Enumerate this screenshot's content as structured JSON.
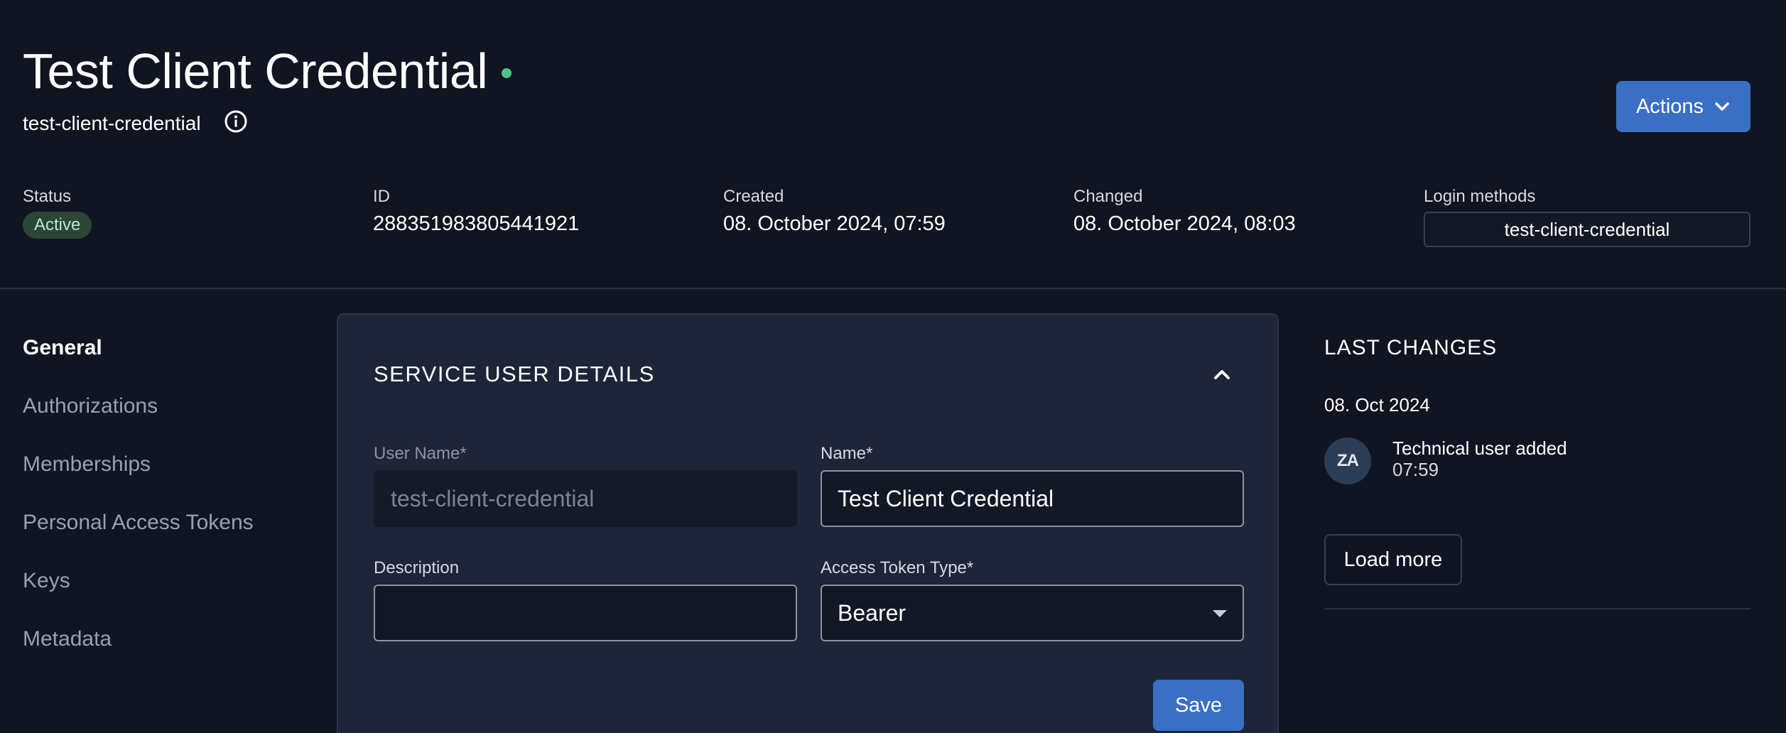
{
  "header": {
    "title": "Test Client Credential",
    "subtitle": "test-client-credential",
    "actions_label": "Actions",
    "status_dot_color": "#4fc38a"
  },
  "meta": {
    "status_label": "Status",
    "status_value": "Active",
    "id_label": "ID",
    "id_value": "288351983805441921",
    "created_label": "Created",
    "created_value": "08. October 2024, 07:59",
    "changed_label": "Changed",
    "changed_value": "08. October 2024, 08:03",
    "login_methods_label": "Login methods",
    "login_methods_value": "test-client-credential"
  },
  "nav": {
    "items": [
      {
        "label": "General",
        "active": true
      },
      {
        "label": "Authorizations"
      },
      {
        "label": "Memberships"
      },
      {
        "label": "Personal Access Tokens"
      },
      {
        "label": "Keys"
      },
      {
        "label": "Metadata"
      }
    ]
  },
  "card": {
    "title": "SERVICE USER DETAILS",
    "username_label": "User Name*",
    "username_value": "test-client-credential",
    "name_label": "Name*",
    "name_value": "Test Client Credential",
    "description_label": "Description",
    "description_value": "",
    "token_type_label": "Access Token Type*",
    "token_type_value": "Bearer",
    "save_label": "Save"
  },
  "changes": {
    "title": "LAST CHANGES",
    "date": "08. Oct 2024",
    "entry_title": "Technical user added",
    "entry_time": "07:59",
    "avatar_initials": "ZA",
    "load_more_label": "Load more"
  },
  "colors": {
    "background": "#111522",
    "accent": "#3a6fc3",
    "card": "#1e2539",
    "active_badge": "#2b4636"
  }
}
